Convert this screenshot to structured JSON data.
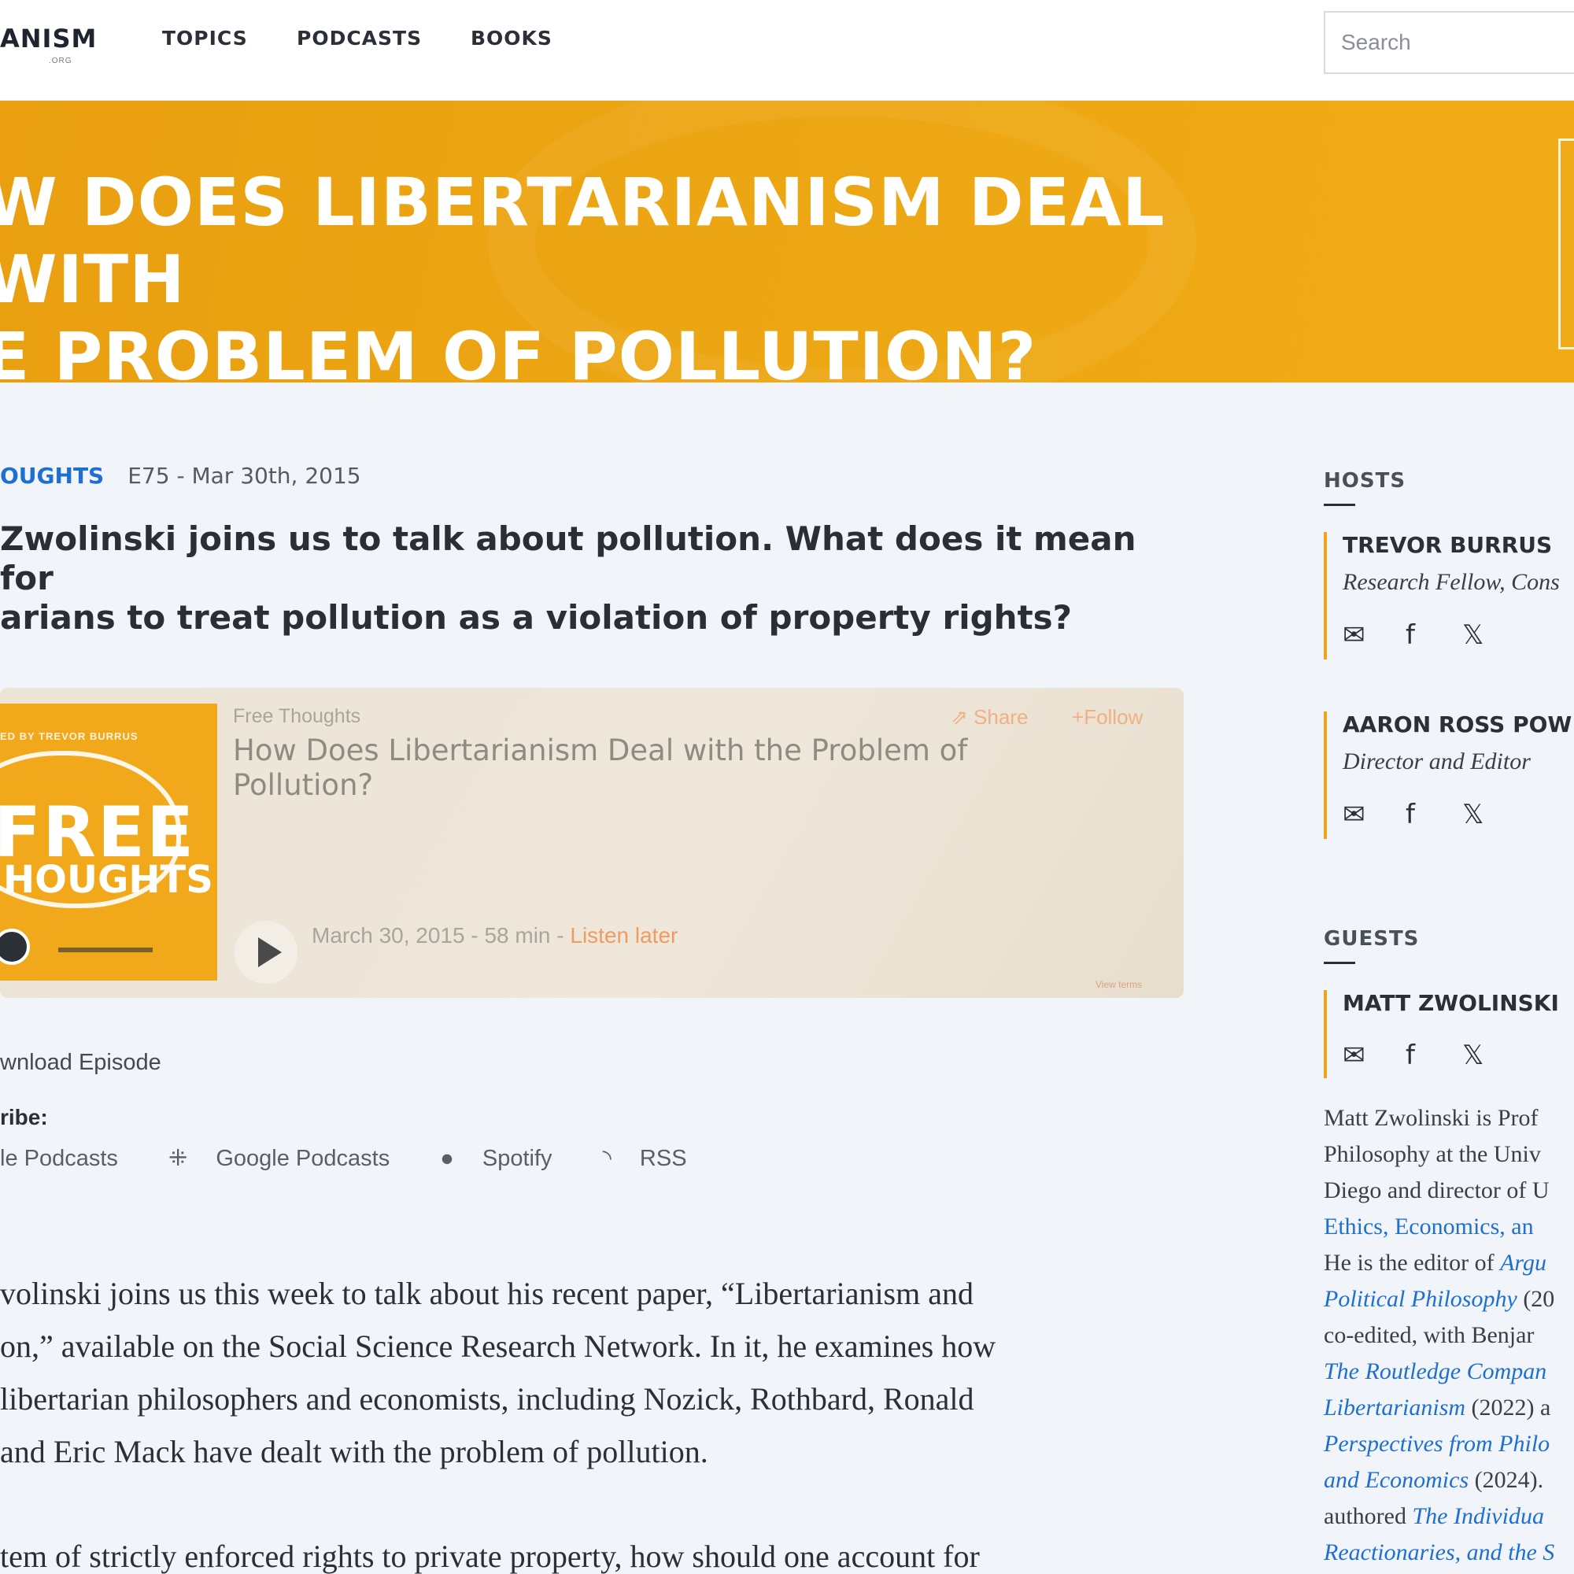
{
  "header": {
    "logo": "ANISM",
    "logo_sub": ".ORG",
    "nav": [
      "TOPICS",
      "PODCASTS",
      "BOOKS"
    ],
    "search_placeholder": "Search"
  },
  "banner": {
    "title": "W DOES LIBERTARIANISM DEAL WITH\nE PROBLEM OF POLLUTION?"
  },
  "episode": {
    "series": "OUGHTS",
    "number_date": "E75 - Mar 30th, 2015",
    "lead": "Zwolinski joins us to talk about pollution. What does it mean for\narians to treat pollution as a violation of property rights?"
  },
  "player": {
    "cover": {
      "hosted_by": "ED BY TREVOR BURRUS",
      "word1": "FREE",
      "word2": "HOUGHTS"
    },
    "series": "Free Thoughts",
    "title": "How Does Libertarianism Deal with the Problem of Pollution?",
    "share": "Share",
    "follow": "Follow",
    "info": "March 30, 2015 - 58 min - ",
    "listen_later": "Listen later",
    "tiny": "View terms"
  },
  "links": {
    "download": "wnload Episode",
    "subscribe": "ribe:",
    "platforms": [
      "le Podcasts",
      "Google Podcasts",
      "Spotify",
      "RSS"
    ]
  },
  "body": [
    "volinski joins us this week to talk about his recent paper, “Libertarianism and\non,” available on the Social Science Research Network. In it, he examines how\n libertarian philosophers and economists, including Nozick, Rothbard, Ronald\nand Eric Mack have dealt with the problem of pollution.",
    "tem of strictly enforced rights to private property, how should one account for"
  ],
  "sidebar": {
    "hosts_heading": "HOSTS",
    "hosts": [
      {
        "name": "TREVOR BURRUS",
        "role": "Research Fellow, Cons"
      },
      {
        "name": "AARON ROSS POW",
        "role": "Director and Editor"
      }
    ],
    "guests_heading": "GUESTS",
    "guests": [
      {
        "name": "MATT ZWOLINSKI"
      }
    ],
    "bio": {
      "l1": "Matt Zwolinski is Prof",
      "l2": "Philosophy at the Univ",
      "l3": "Diego and director of U",
      "l4": "Ethics, Economics, an",
      "l5a": "He is the editor of ",
      "l5b": "Argu",
      "l6a": "Political Philosophy",
      "l6b": " (20",
      "l7": "co-edited, with Benjar",
      "l8": "The Routledge Compan",
      "l9a": "Libertarianism",
      "l9b": " (2022) a",
      "l10": "Perspectives from Philo",
      "l11a": "and Economics",
      "l11b": " (2024).",
      "l12a": "authored ",
      "l12b": "The Individua",
      "l13": "Reactionaries, and the S"
    }
  },
  "colors": {
    "banner": "#eda613",
    "accent_blue": "#1e6fd0",
    "accent_orange": "#f0a31b"
  }
}
